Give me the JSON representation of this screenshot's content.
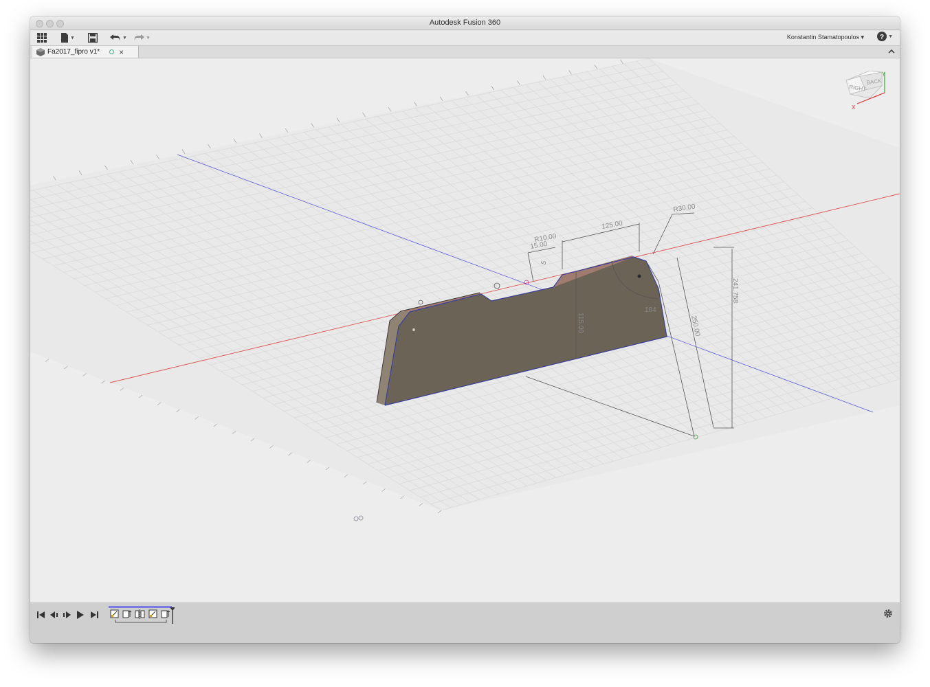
{
  "window": {
    "title": "Autodesk Fusion 360"
  },
  "toolbar": {
    "icons": [
      "apps-grid-icon",
      "file-icon",
      "save-icon",
      "undo-icon",
      "redo-icon"
    ],
    "user_name": "Konstantin Stamatopoulos ▾",
    "help_icon": "help-icon"
  },
  "tabs": [
    {
      "label": "Fa2017_fipro v1*"
    }
  ],
  "viewcube": {
    "right_label": "RIGHT",
    "back_label": "BACK",
    "x_axis": "X",
    "y_axis": "Y"
  },
  "dimensions": {
    "r30": "R30.00",
    "dim125": "125.00",
    "r10": "R10.00",
    "dim15": "15.00",
    "dim5": "5",
    "dim115": "115.00",
    "dim104": "104",
    "dim250": "250.00",
    "dim241": "241.758"
  },
  "timeline": {
    "controls": [
      "skip-to-start-icon",
      "step-back-icon",
      "step-forward-icon",
      "play-icon",
      "skip-to-end-icon"
    ],
    "features": [
      "sketch",
      "extrude",
      "mirror",
      "sketch",
      "extrude"
    ]
  },
  "colors": {
    "x_axis": "#e05050",
    "z_axis": "#5a5ae0",
    "body_face": "#6b6356",
    "body_edge": "#b08f80",
    "grid": "#d6d6d6"
  }
}
